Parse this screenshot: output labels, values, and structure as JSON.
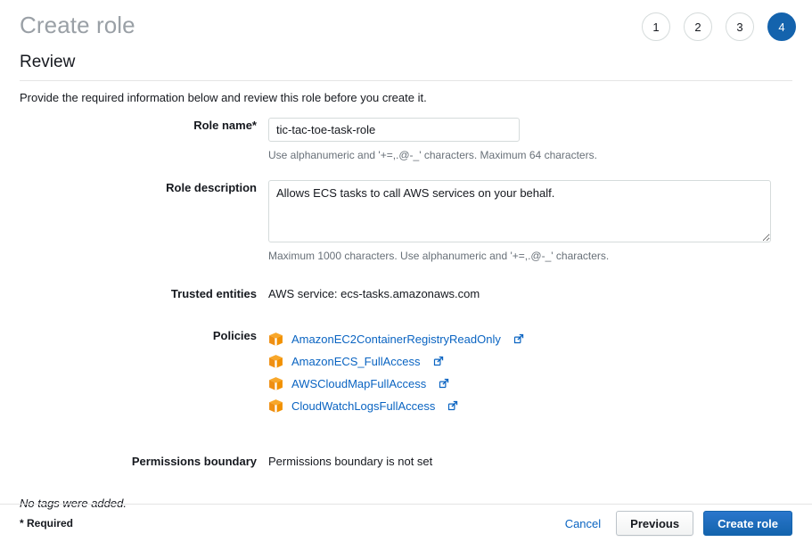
{
  "header": {
    "title": "Create role",
    "steps": [
      {
        "label": "1",
        "active": false
      },
      {
        "label": "2",
        "active": false
      },
      {
        "label": "3",
        "active": false
      },
      {
        "label": "4",
        "active": true
      }
    ]
  },
  "section": {
    "title": "Review",
    "description": "Provide the required information below and review this role before you create it."
  },
  "form": {
    "role_name": {
      "label": "Role name*",
      "value": "tic-tac-toe-task-role",
      "placeholder": "",
      "hint": "Use alphanumeric and '+=,.@-_' characters. Maximum 64 characters."
    },
    "role_description": {
      "label": "Role description",
      "value": "Allows ECS tasks to call AWS services on your behalf.",
      "placeholder": "",
      "hint": "Maximum 1000 characters. Use alphanumeric and '+=,.@-_' characters."
    },
    "trusted_entities": {
      "label": "Trusted entities",
      "value": "AWS service: ecs-tasks.amazonaws.com"
    },
    "policies": {
      "label": "Policies",
      "items": [
        {
          "name": "AmazonEC2ContainerRegistryReadOnly",
          "icon": "policy-cube-icon",
          "external_icon": "external-link-icon"
        },
        {
          "name": "AmazonECS_FullAccess",
          "icon": "policy-cube-icon",
          "external_icon": "external-link-icon"
        },
        {
          "name": "AWSCloudMapFullAccess",
          "icon": "policy-cube-icon",
          "external_icon": "external-link-icon"
        },
        {
          "name": "CloudWatchLogsFullAccess",
          "icon": "policy-cube-icon",
          "external_icon": "external-link-icon"
        }
      ]
    },
    "permissions_boundary": {
      "label": "Permissions boundary",
      "value": "Permissions boundary is not set"
    }
  },
  "tags_note": "No tags were added.",
  "footer": {
    "required_note": "* Required",
    "cancel_label": "Cancel",
    "previous_label": "Previous",
    "create_label": "Create role"
  },
  "colors": {
    "accent_blue": "#1463ad",
    "link_blue": "#0a64c2",
    "policy_orange": "#f29100",
    "title_gray": "#9aa0a6",
    "border_gray": "#d5dbdb"
  }
}
